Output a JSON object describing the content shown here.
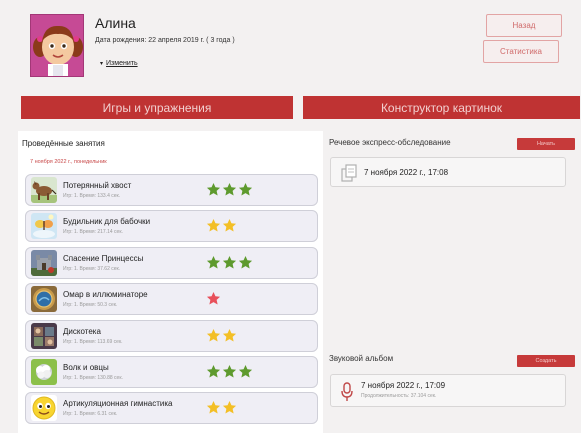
{
  "profile": {
    "name": "Алина",
    "birth": "Дата рождения: 22 апреля 2019 г. ( 3 года )",
    "edit_label": "Изменить"
  },
  "header_buttons": {
    "back": "Назад",
    "stats": "Статистика"
  },
  "main_buttons": {
    "games": "Игры и упражнения",
    "constructor": "Конструктор картинок"
  },
  "sessions": {
    "title": "Проведённые занятия",
    "date": "7 ноября 2022 г., понедельник",
    "items": [
      {
        "title": "Потерянный хвост",
        "subtitle": "Игр: 1. Время: 133.4 сек.",
        "stars": 3,
        "icon": "donkey-icon"
      },
      {
        "title": "Будильник для бабочки",
        "subtitle": "Игр: 1. Время: 217.14 сек.",
        "stars": 2,
        "icon": "butterfly-icon"
      },
      {
        "title": "Спасение Принцессы",
        "subtitle": "Игр: 1. Время: 37.62 сек.",
        "stars": 3,
        "icon": "castle-icon"
      },
      {
        "title": "Омар в иллюминаторе",
        "subtitle": "Игр: 1. Время: 50.3 сек.",
        "stars": 1,
        "icon": "porthole-icon"
      },
      {
        "title": "Дискотека",
        "subtitle": "Игр: 1. Время: 113.69 сек.",
        "stars": 2,
        "icon": "disco-icon"
      },
      {
        "title": "Волк и овцы",
        "subtitle": "Игр: 1. Время: 130.88 сек.",
        "stars": 3,
        "icon": "sheep-icon"
      },
      {
        "title": "Артикуляционная гимнастика",
        "subtitle": "Игр: 1. Время: 6.31 сек.",
        "stars": 2,
        "icon": "smiley-icon"
      }
    ]
  },
  "speech_exam": {
    "title": "Речевое экспресс-обследование",
    "button": "Начать",
    "entry": "7 ноября 2022 г., 17:08"
  },
  "sound_album": {
    "title": "Звуковой альбом",
    "button": "Создать",
    "entry": "7 ноября 2022 г., 17:09",
    "entry_sub": "Продолжительность: 37.104 сек."
  },
  "colors": {
    "accent_red": "#bf3333",
    "star_3": "#5e9a2e",
    "star_2": "#f3bf26",
    "star_1": "#e8505b",
    "row_bg": "#efeef5"
  }
}
